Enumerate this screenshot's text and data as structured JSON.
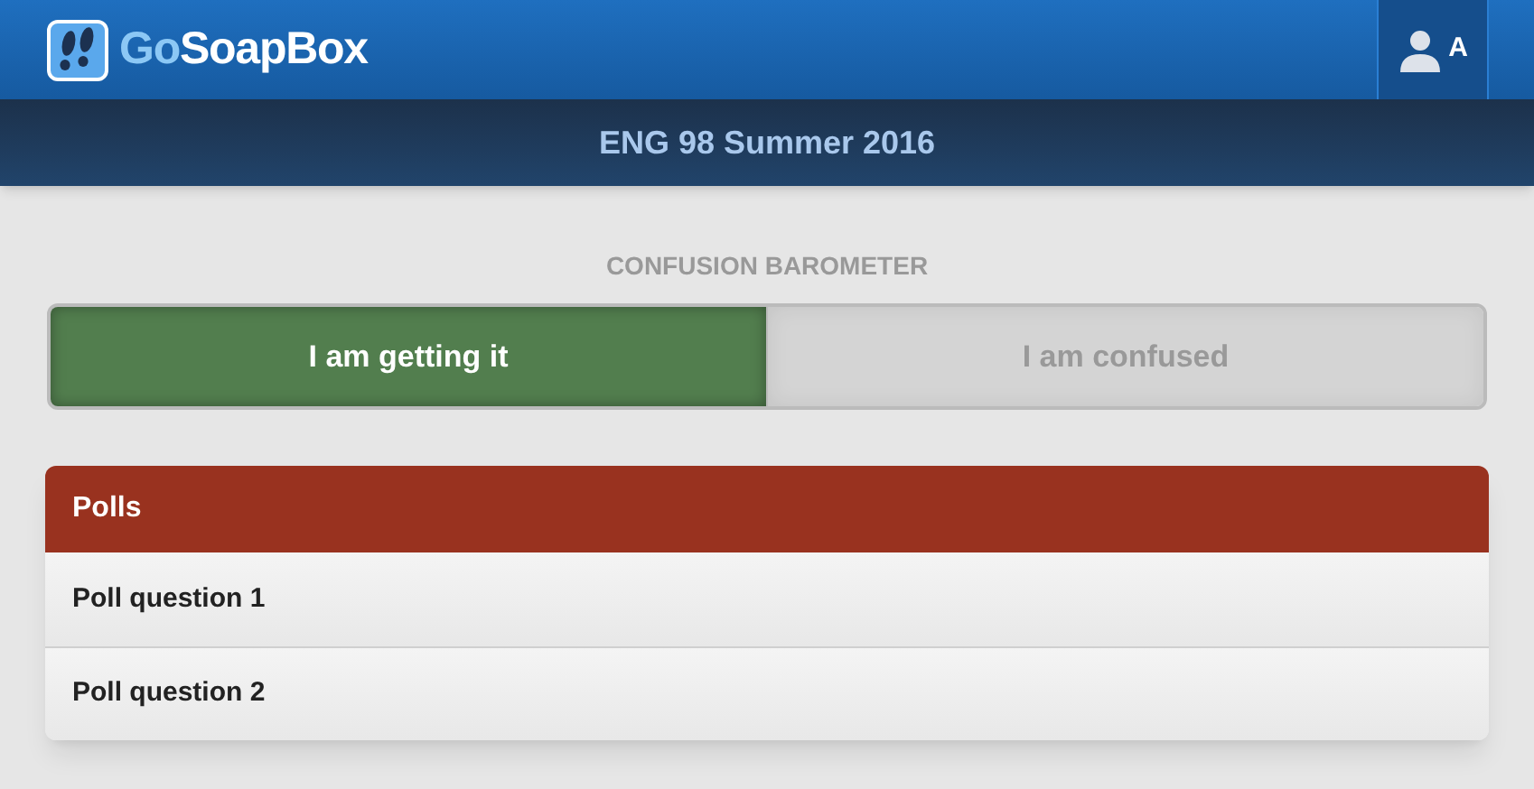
{
  "header": {
    "brand": {
      "prefix": "Go",
      "rest": "SoapBox"
    },
    "user_initial": "A"
  },
  "course_title": "ENG 98 Summer 2016",
  "barometer": {
    "title": "CONFUSION BAROMETER",
    "options": [
      {
        "label": "I am getting it",
        "selected": true
      },
      {
        "label": "I am confused",
        "selected": false
      }
    ]
  },
  "polls": {
    "title": "Polls",
    "items": [
      "Poll question 1",
      "Poll question 2"
    ]
  }
}
